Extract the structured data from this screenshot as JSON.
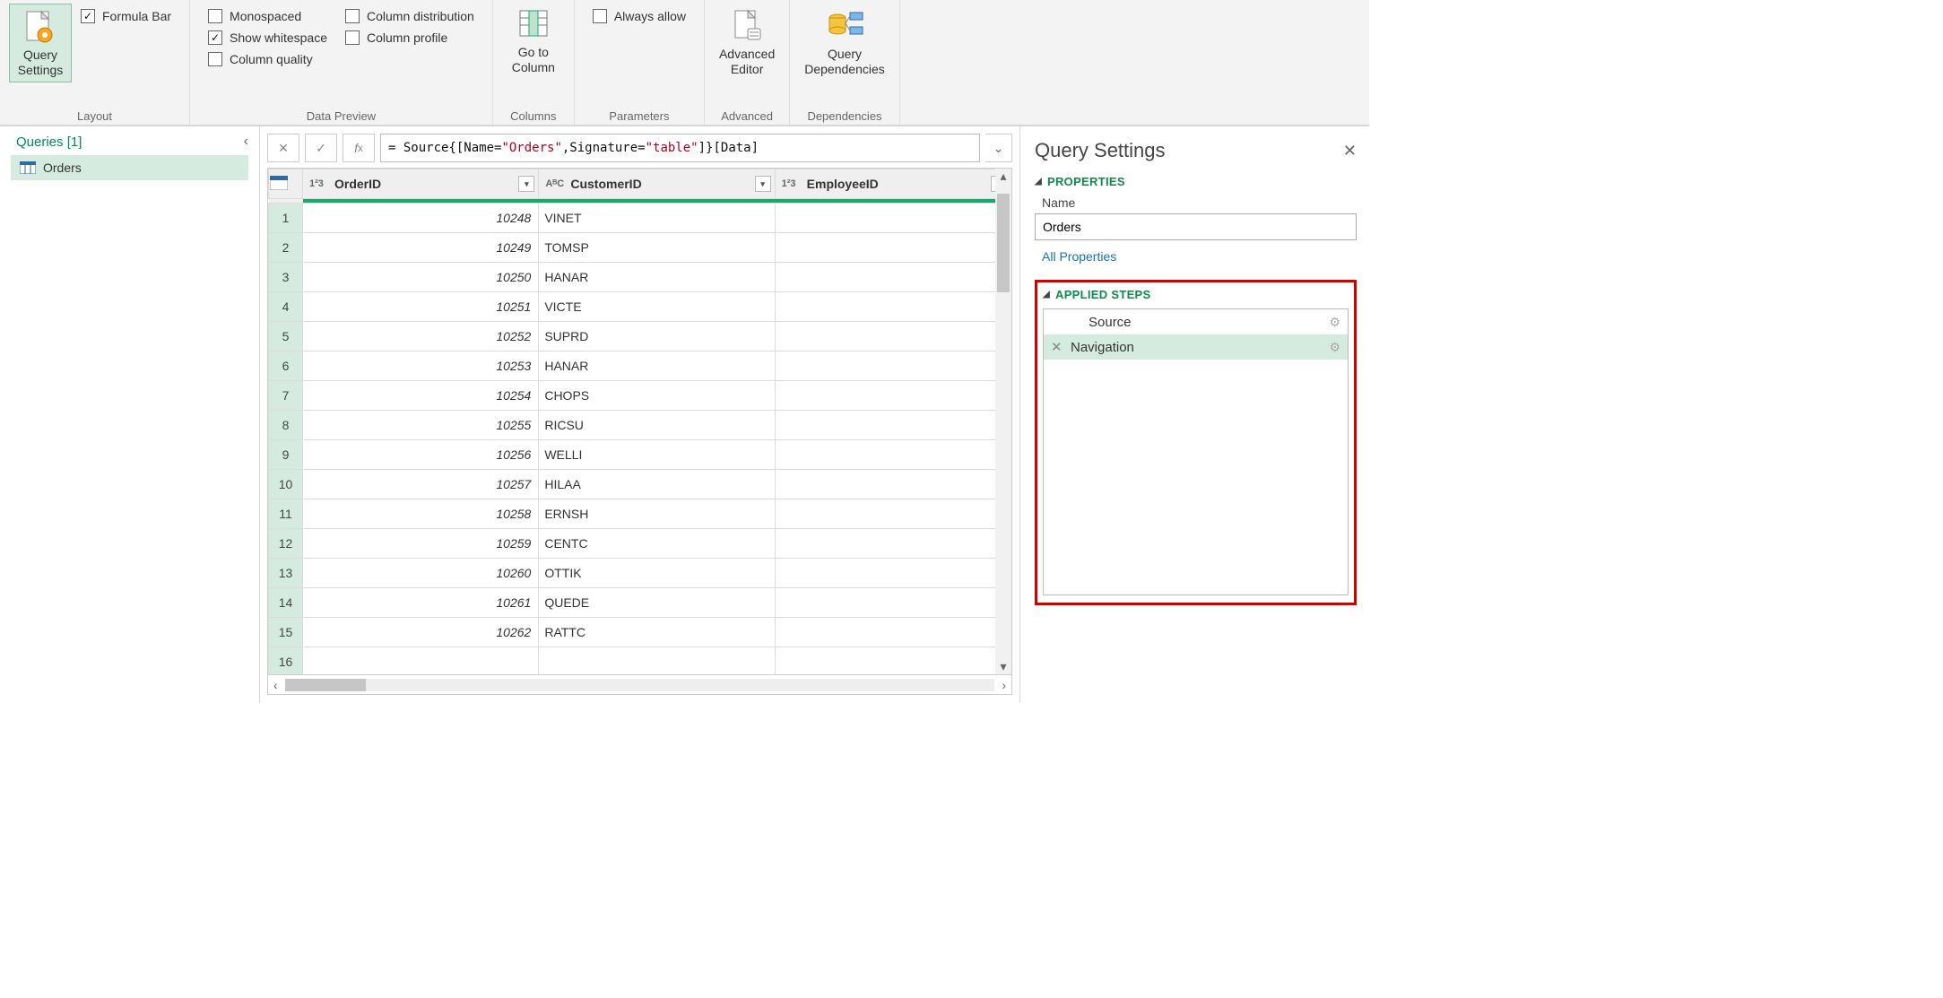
{
  "ribbon": {
    "query_settings": "Query\nSettings",
    "layout_label": "Layout",
    "formula_bar": "Formula Bar",
    "monospaced": "Monospaced",
    "show_whitespace": "Show whitespace",
    "column_quality": "Column quality",
    "column_distribution": "Column distribution",
    "column_profile": "Column profile",
    "data_preview_label": "Data Preview",
    "goto_column": "Go to\nColumn",
    "columns_label": "Columns",
    "always_allow": "Always allow",
    "parameters_label": "Parameters",
    "advanced_editor": "Advanced\nEditor",
    "advanced_label": "Advanced",
    "query_dependencies": "Query\nDependencies",
    "dependencies_label": "Dependencies"
  },
  "queries": {
    "header": "Queries [1]",
    "items": [
      "Orders"
    ]
  },
  "fx": {
    "prefix": "= Source{[Name=",
    "val1": "\"Orders\"",
    "mid": ",Signature=",
    "val2": "\"table\"",
    "suffix": "]}[Data]"
  },
  "grid": {
    "columns": [
      {
        "name": "OrderID",
        "type": "1²3"
      },
      {
        "name": "CustomerID",
        "type": "AᴮC"
      },
      {
        "name": "EmployeeID",
        "type": "1²3"
      }
    ],
    "rows": [
      {
        "n": 1,
        "OrderID": "10248",
        "CustomerID": "VINET",
        "EmployeeID": ""
      },
      {
        "n": 2,
        "OrderID": "10249",
        "CustomerID": "TOMSP",
        "EmployeeID": ""
      },
      {
        "n": 3,
        "OrderID": "10250",
        "CustomerID": "HANAR",
        "EmployeeID": ""
      },
      {
        "n": 4,
        "OrderID": "10251",
        "CustomerID": "VICTE",
        "EmployeeID": ""
      },
      {
        "n": 5,
        "OrderID": "10252",
        "CustomerID": "SUPRD",
        "EmployeeID": ""
      },
      {
        "n": 6,
        "OrderID": "10253",
        "CustomerID": "HANAR",
        "EmployeeID": ""
      },
      {
        "n": 7,
        "OrderID": "10254",
        "CustomerID": "CHOPS",
        "EmployeeID": ""
      },
      {
        "n": 8,
        "OrderID": "10255",
        "CustomerID": "RICSU",
        "EmployeeID": ""
      },
      {
        "n": 9,
        "OrderID": "10256",
        "CustomerID": "WELLI",
        "EmployeeID": ""
      },
      {
        "n": 10,
        "OrderID": "10257",
        "CustomerID": "HILAA",
        "EmployeeID": ""
      },
      {
        "n": 11,
        "OrderID": "10258",
        "CustomerID": "ERNSH",
        "EmployeeID": ""
      },
      {
        "n": 12,
        "OrderID": "10259",
        "CustomerID": "CENTC",
        "EmployeeID": ""
      },
      {
        "n": 13,
        "OrderID": "10260",
        "CustomerID": "OTTIK",
        "EmployeeID": ""
      },
      {
        "n": 14,
        "OrderID": "10261",
        "CustomerID": "QUEDE",
        "EmployeeID": ""
      },
      {
        "n": 15,
        "OrderID": "10262",
        "CustomerID": "RATTC",
        "EmployeeID": ""
      },
      {
        "n": 16,
        "OrderID": "",
        "CustomerID": "",
        "EmployeeID": ""
      }
    ]
  },
  "settings": {
    "title": "Query Settings",
    "properties_header": "PROPERTIES",
    "name_label": "Name",
    "name_value": "Orders",
    "all_properties": "All Properties",
    "applied_header": "APPLIED STEPS",
    "steps": [
      {
        "label": "Source",
        "selected": false
      },
      {
        "label": "Navigation",
        "selected": true
      }
    ]
  }
}
